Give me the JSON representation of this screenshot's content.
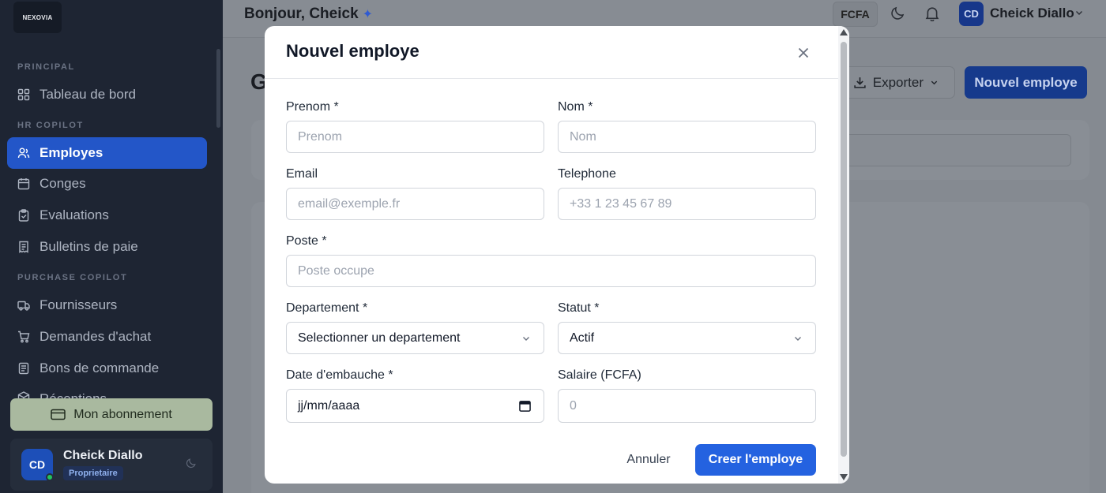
{
  "app": {
    "logo": "NEXOVIA"
  },
  "sidebar": {
    "sections": [
      "PRINCIPAL",
      "HR COPILOT",
      "PURCHASE COPILOT"
    ],
    "items": [
      {
        "label": "Tableau de bord",
        "icon": "grid-icon"
      },
      {
        "label": "Employes",
        "icon": "users-icon",
        "active": true
      },
      {
        "label": "Conges",
        "icon": "calendar-icon"
      },
      {
        "label": "Evaluations",
        "icon": "clipboard-icon"
      },
      {
        "label": "Bulletins de paie",
        "icon": "receipt-icon"
      },
      {
        "label": "Fournisseurs",
        "icon": "truck-icon"
      },
      {
        "label": "Demandes d'achat",
        "icon": "cart-icon"
      },
      {
        "label": "Bons de commande",
        "icon": "document-icon"
      },
      {
        "label": "Réceptions",
        "icon": "package-icon"
      }
    ],
    "subscription_label": "Mon abonnement",
    "user": {
      "initials": "CD",
      "name": "Cheick Diallo",
      "role": "Proprietaire"
    }
  },
  "topbar": {
    "greeting": "Bonjour, Cheick",
    "currency": "FCFA",
    "user_initials": "CD",
    "user_name": "Cheick Diallo"
  },
  "page": {
    "title_partial": "G",
    "export_label": "Exporter",
    "new_label": "Nouvel employe"
  },
  "modal": {
    "title": "Nouvel employe",
    "fields": {
      "prenom": {
        "label": "Prenom *",
        "placeholder": "Prenom"
      },
      "nom": {
        "label": "Nom *",
        "placeholder": "Nom"
      },
      "email": {
        "label": "Email",
        "placeholder": "email@exemple.fr"
      },
      "telephone": {
        "label": "Telephone",
        "placeholder": "+33 1 23 45 67 89"
      },
      "poste": {
        "label": "Poste *",
        "placeholder": "Poste occupe"
      },
      "departement": {
        "label": "Departement *",
        "value": "Selectionner un departement"
      },
      "statut": {
        "label": "Statut *",
        "value": "Actif"
      },
      "date_embauche": {
        "label": "Date d'embauche *",
        "value": "jj/mm/aaaa"
      },
      "salaire": {
        "label": "Salaire (FCFA)",
        "placeholder": "0"
      }
    },
    "cancel_label": "Annuler",
    "submit_label": "Creer l'employe"
  },
  "colors": {
    "accent": "#2462e0",
    "sidebar_bg": "#1e2533",
    "active_nav": "#2356c8"
  }
}
